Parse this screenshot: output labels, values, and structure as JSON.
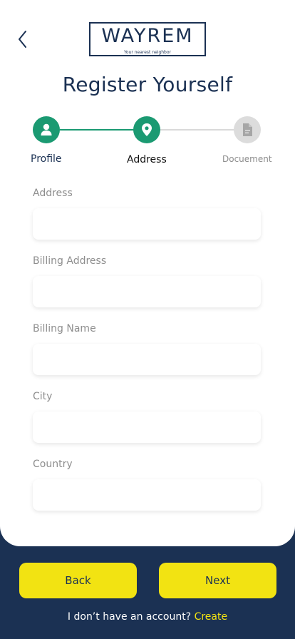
{
  "header": {
    "logo_text": "WAYREM",
    "logo_tagline": "Your nearest neighbor",
    "title": "Register Yourself"
  },
  "steps": [
    {
      "label": "Profile",
      "icon": "user-icon",
      "state": "completed"
    },
    {
      "label": "Address",
      "icon": "location-pin-icon",
      "state": "active"
    },
    {
      "label": "Docuement",
      "icon": "document-icon",
      "state": "pending"
    }
  ],
  "form": {
    "fields": [
      {
        "label": "Address",
        "value": ""
      },
      {
        "label": "Billing Address",
        "value": ""
      },
      {
        "label": "Billing Name",
        "value": ""
      },
      {
        "label": "City",
        "value": ""
      },
      {
        "label": "Country",
        "value": ""
      }
    ]
  },
  "actions": {
    "back_label": "Back",
    "next_label": "Next"
  },
  "footer": {
    "prompt": "I don’t have an account?",
    "link": "Create"
  },
  "colors": {
    "navy": "#1b3153",
    "green": "#1b9a72",
    "yellow": "#f2e312",
    "inactive": "#dcdcdc"
  }
}
